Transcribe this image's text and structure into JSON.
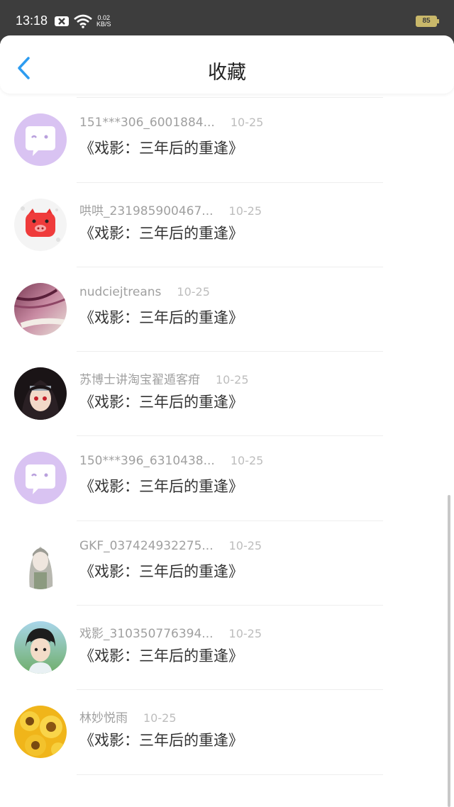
{
  "status_bar": {
    "time": "13:18",
    "speed_value": "0.02",
    "speed_unit": "KB/S",
    "battery": "85"
  },
  "header": {
    "title": "收藏"
  },
  "items": [
    {
      "user": "",
      "date": "",
      "title": "《戏影：三年后的重逢》",
      "avatar": "qq-penguin"
    },
    {
      "user": "151***306_6001884...",
      "date": "10-25",
      "title": "《戏影：三年后的重逢》",
      "avatar": "chat-bubble"
    },
    {
      "user": "哄哄_231985900467...",
      "date": "10-25",
      "title": "《戏影：三年后的重逢》",
      "avatar": "red-pig"
    },
    {
      "user": "nudciejtreans",
      "date": "10-25",
      "title": "《戏影：三年后的重逢》",
      "avatar": "flower-photo"
    },
    {
      "user": "苏博士讲淘宝翟遁客疳",
      "date": "10-25",
      "title": "《戏影：三年后的重逢》",
      "avatar": "anime-ninja"
    },
    {
      "user": "150***396_6310438...",
      "date": "10-25",
      "title": "《戏影：三年后的重逢》",
      "avatar": "chat-bubble"
    },
    {
      "user": "GKF_037424932275...",
      "date": "10-25",
      "title": "《戏影：三年后的重逢》",
      "avatar": "girl-sketch"
    },
    {
      "user": "戏影_310350776394...",
      "date": "10-25",
      "title": "《戏影：三年后的重逢》",
      "avatar": "anime-boy"
    },
    {
      "user": "林妙悦雨",
      "date": "10-25",
      "title": "《戏影：三年后的重逢》",
      "avatar": "sunflowers"
    }
  ]
}
